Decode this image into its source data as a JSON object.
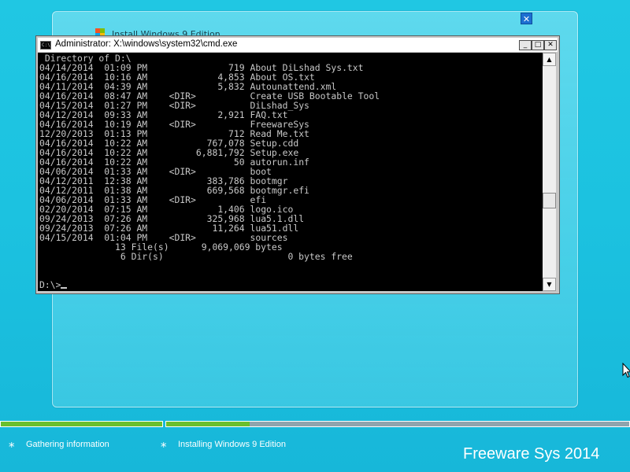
{
  "installer": {
    "title": "Install Windows 9 Edition"
  },
  "cmd": {
    "title": "Administrator: X:\\windows\\system32\\cmd.exe",
    "icon_text": "C:\\",
    "buttons": {
      "minimize": "_",
      "maximize": "□",
      "close": "✕"
    },
    "directory_header": " Directory of D:\\",
    "entries": [
      {
        "date": "04/14/2014",
        "time": "01:09 PM",
        "size": "719",
        "dir": false,
        "name": "About DiLshad Sys.txt"
      },
      {
        "date": "04/16/2014",
        "time": "10:16 AM",
        "size": "4,853",
        "dir": false,
        "name": "About OS.txt"
      },
      {
        "date": "04/11/2014",
        "time": "04:39 AM",
        "size": "5,832",
        "dir": false,
        "name": "Autounattend.xml"
      },
      {
        "date": "04/16/2014",
        "time": "08:47 AM",
        "size": "",
        "dir": true,
        "name": "Create USB Bootable Tool"
      },
      {
        "date": "04/15/2014",
        "time": "01:27 PM",
        "size": "",
        "dir": true,
        "name": "DiLshad_Sys"
      },
      {
        "date": "04/12/2014",
        "time": "09:33 AM",
        "size": "2,921",
        "dir": false,
        "name": "FAQ.txt"
      },
      {
        "date": "04/16/2014",
        "time": "10:19 AM",
        "size": "",
        "dir": true,
        "name": "FreewareSys"
      },
      {
        "date": "12/20/2013",
        "time": "01:13 PM",
        "size": "712",
        "dir": false,
        "name": "Read Me.txt"
      },
      {
        "date": "04/16/2014",
        "time": "10:22 AM",
        "size": "767,078",
        "dir": false,
        "name": "Setup.cdd"
      },
      {
        "date": "04/16/2014",
        "time": "10:22 AM",
        "size": "6,881,792",
        "dir": false,
        "name": "Setup.exe"
      },
      {
        "date": "04/16/2014",
        "time": "10:22 AM",
        "size": "50",
        "dir": false,
        "name": "autorun.inf"
      },
      {
        "date": "04/06/2014",
        "time": "01:33 AM",
        "size": "",
        "dir": true,
        "name": "boot"
      },
      {
        "date": "04/12/2011",
        "time": "12:38 AM",
        "size": "383,786",
        "dir": false,
        "name": "bootmgr"
      },
      {
        "date": "04/12/2011",
        "time": "01:38 AM",
        "size": "669,568",
        "dir": false,
        "name": "bootmgr.efi"
      },
      {
        "date": "04/06/2014",
        "time": "01:33 AM",
        "size": "",
        "dir": true,
        "name": "efi"
      },
      {
        "date": "02/20/2014",
        "time": "07:15 AM",
        "size": "1,406",
        "dir": false,
        "name": "logo.ico"
      },
      {
        "date": "09/24/2013",
        "time": "07:26 AM",
        "size": "325,968",
        "dir": false,
        "name": "lua5.1.dll"
      },
      {
        "date": "09/24/2013",
        "time": "07:26 AM",
        "size": "11,264",
        "dir": false,
        "name": "lua51.dll"
      },
      {
        "date": "04/15/2014",
        "time": "01:04 PM",
        "size": "",
        "dir": true,
        "name": "sources"
      }
    ],
    "dir_label": "<DIR>",
    "summary": {
      "files_count": "13",
      "files_label": "File(s)",
      "files_bytes": "9,069,069",
      "bytes_label": "bytes",
      "dirs_count": "6",
      "dirs_label": "Dir(s)",
      "dirs_bytes": "0",
      "free_label": "bytes free"
    },
    "prompt": "D:\\>"
  },
  "progress": {
    "step1": {
      "label": "Gathering information",
      "fill": 1.0
    },
    "step2": {
      "label": "Installing Windows 9 Edition",
      "fill": 0.18
    }
  },
  "brand": "Freeware Sys 2014",
  "colors": {
    "desktop": "#1cc2e0",
    "progress_fill": "#6abf2d",
    "console_bg": "#000000",
    "console_text": "#c8c8c8"
  }
}
